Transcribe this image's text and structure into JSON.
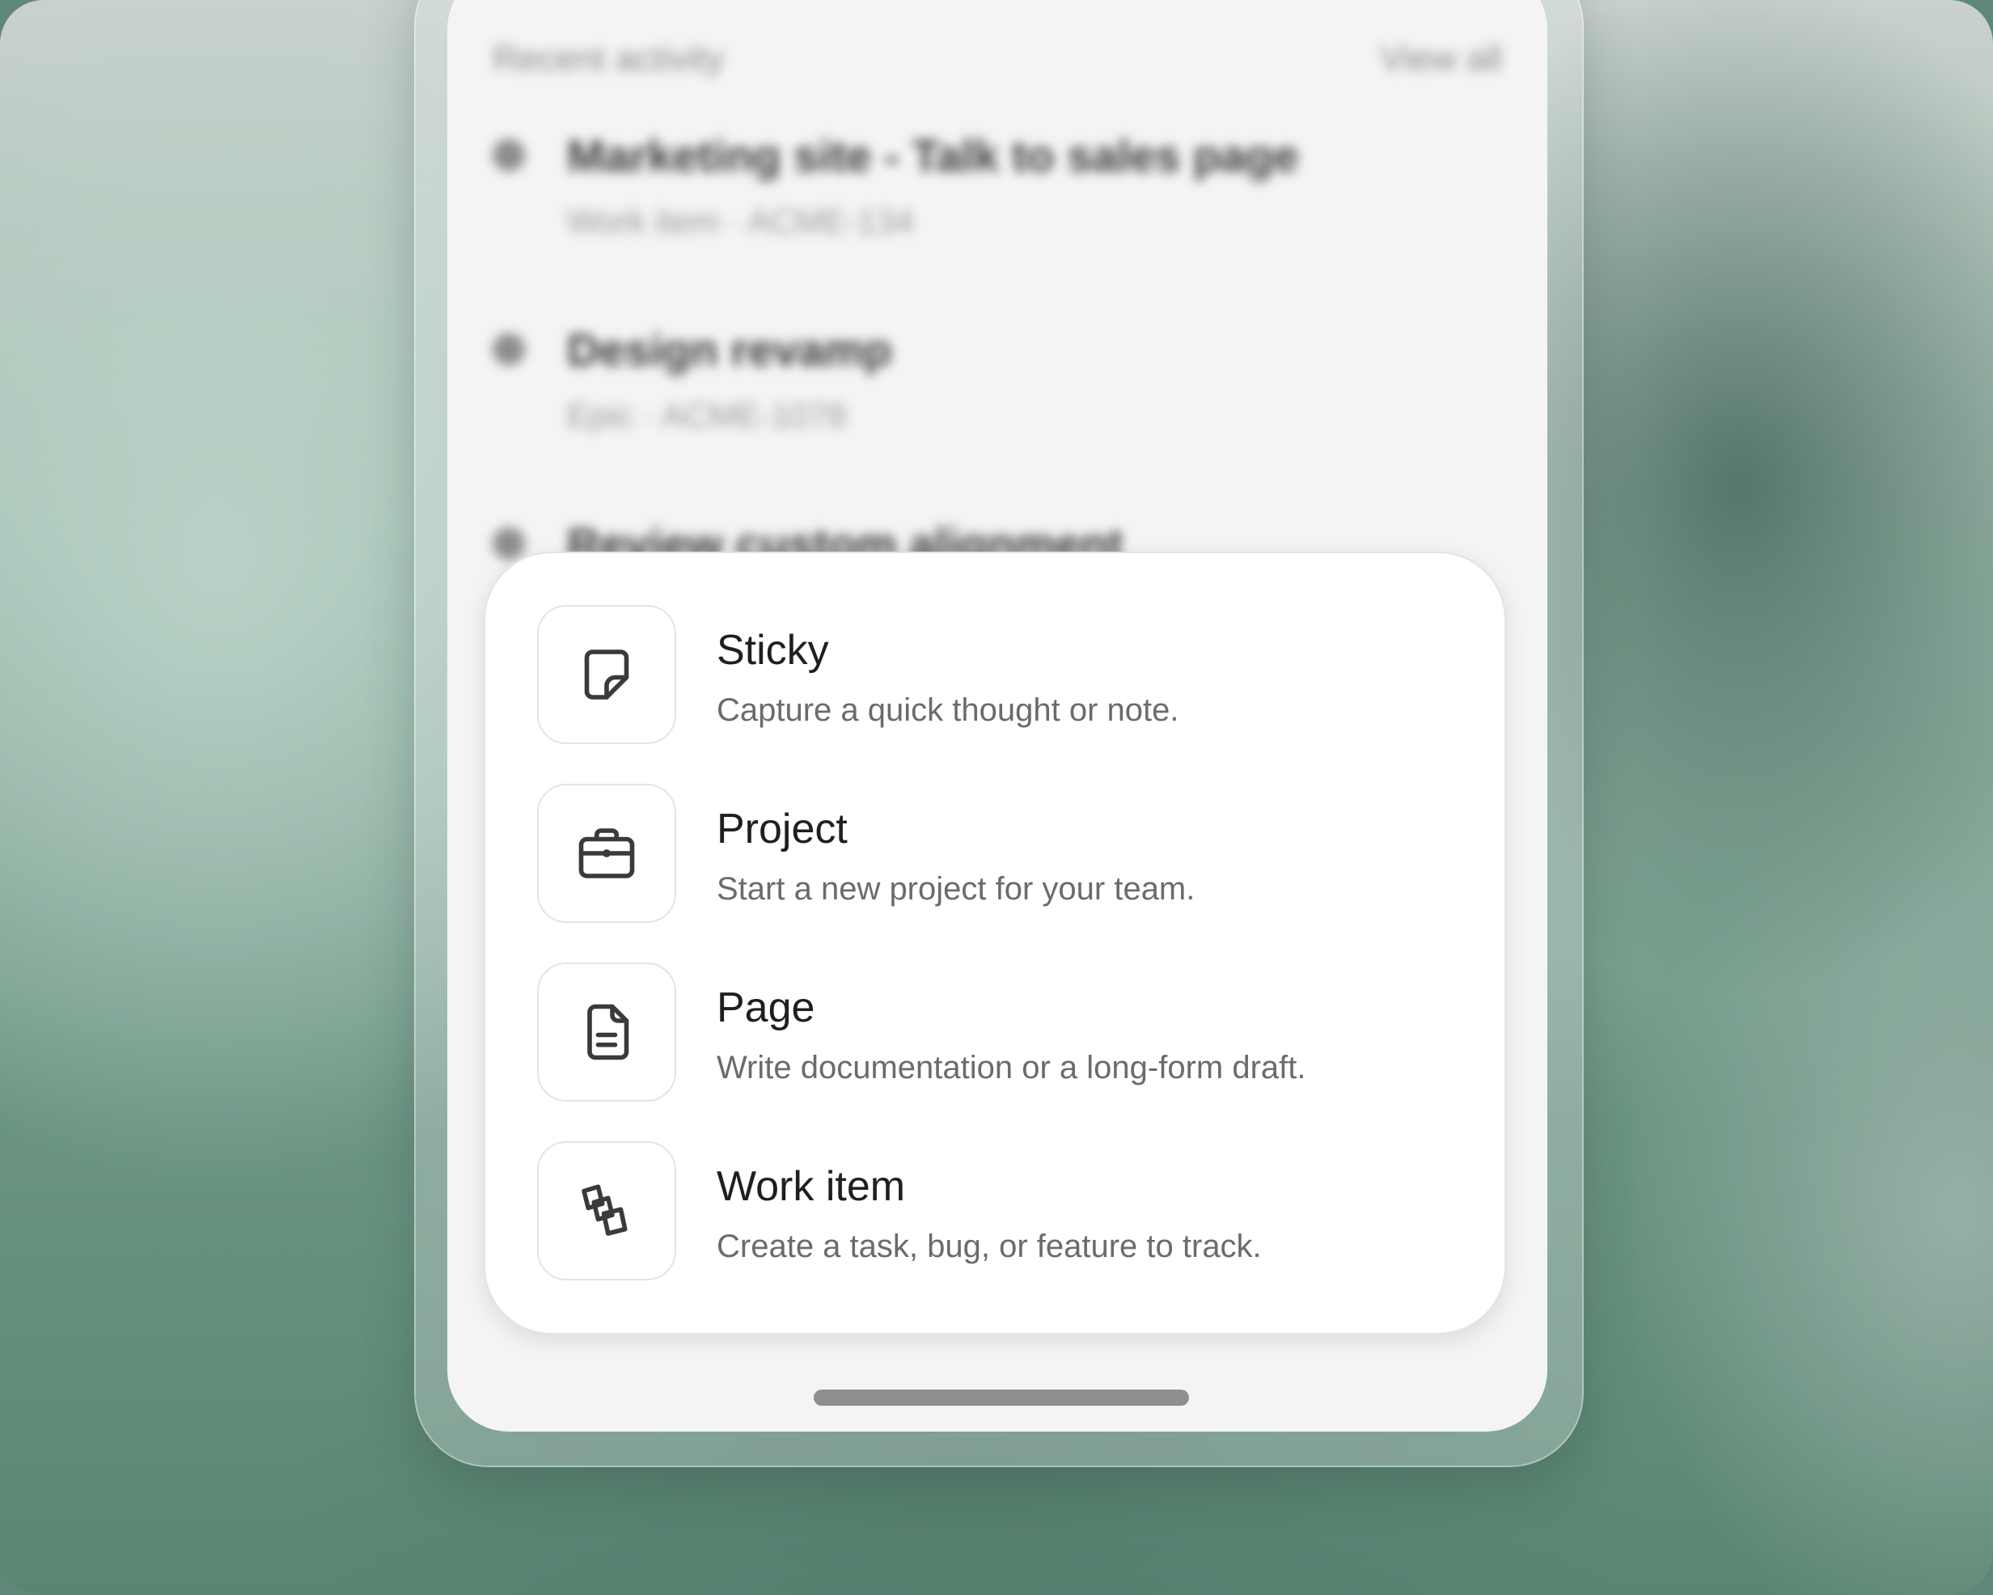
{
  "background_screen": {
    "header": {
      "title": "Recent activity",
      "view_all": "View all"
    },
    "items": [
      {
        "title": "Marketing site - Talk to sales page",
        "subtitle": "Work item  ·  ACME-134"
      },
      {
        "title": "Design revamp",
        "subtitle": "Epic  ·  ACME-1078"
      },
      {
        "title": "Review custom alignment",
        "subtitle": ""
      }
    ]
  },
  "create_menu": {
    "items": [
      {
        "icon": "sticky-note-icon",
        "label": "Sticky",
        "description": "Capture a quick thought or note."
      },
      {
        "icon": "briefcase-icon",
        "label": "Project",
        "description": "Start a new project for your team."
      },
      {
        "icon": "document-icon",
        "label": "Page",
        "description": "Write documentation or a long-form draft."
      },
      {
        "icon": "work-item-icon",
        "label": "Work item",
        "description": "Create a task, bug, or feature to track."
      }
    ]
  },
  "colors": {
    "icon_stroke": "#3a3a3a",
    "label": "#1f1f1f",
    "description": "#6b6b6b",
    "card_bg": "#ffffff",
    "screen_bg": "#f4f4f4"
  }
}
